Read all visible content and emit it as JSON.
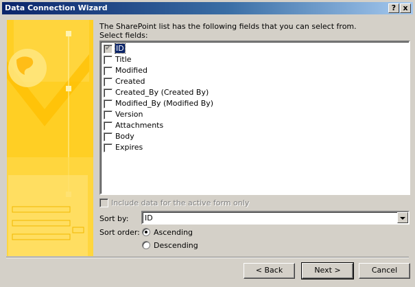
{
  "window": {
    "title": "Data Connection Wizard",
    "help_label": "?",
    "close_label": "x"
  },
  "intro": "The SharePoint list has the following fields that you can select from.",
  "select_fields_label": "Select fields:",
  "fields": [
    {
      "label": "ID",
      "checked": true,
      "disabled": true
    },
    {
      "label": "Title",
      "checked": false
    },
    {
      "label": "Modified",
      "checked": false
    },
    {
      "label": "Created",
      "checked": false
    },
    {
      "label": "Created_By (Created By)",
      "checked": false
    },
    {
      "label": "Modified_By (Modified By)",
      "checked": false
    },
    {
      "label": "Version",
      "checked": false
    },
    {
      "label": "Attachments",
      "checked": false
    },
    {
      "label": "Body",
      "checked": false
    },
    {
      "label": "Expires",
      "checked": false
    }
  ],
  "include_active_form": {
    "label": "Include data for the active form only",
    "checked": false,
    "disabled": true
  },
  "sort_by": {
    "label": "Sort by:",
    "value": "ID"
  },
  "sort_order": {
    "label": "Sort order:",
    "options": [
      "Ascending",
      "Descending"
    ],
    "selected": "Ascending"
  },
  "buttons": {
    "back": "< Back",
    "next": "Next >",
    "cancel": "Cancel"
  },
  "colors": {
    "title_bar": "#0a246a",
    "panel_art": "#ffcc1a",
    "face": "#d4d0c8"
  }
}
